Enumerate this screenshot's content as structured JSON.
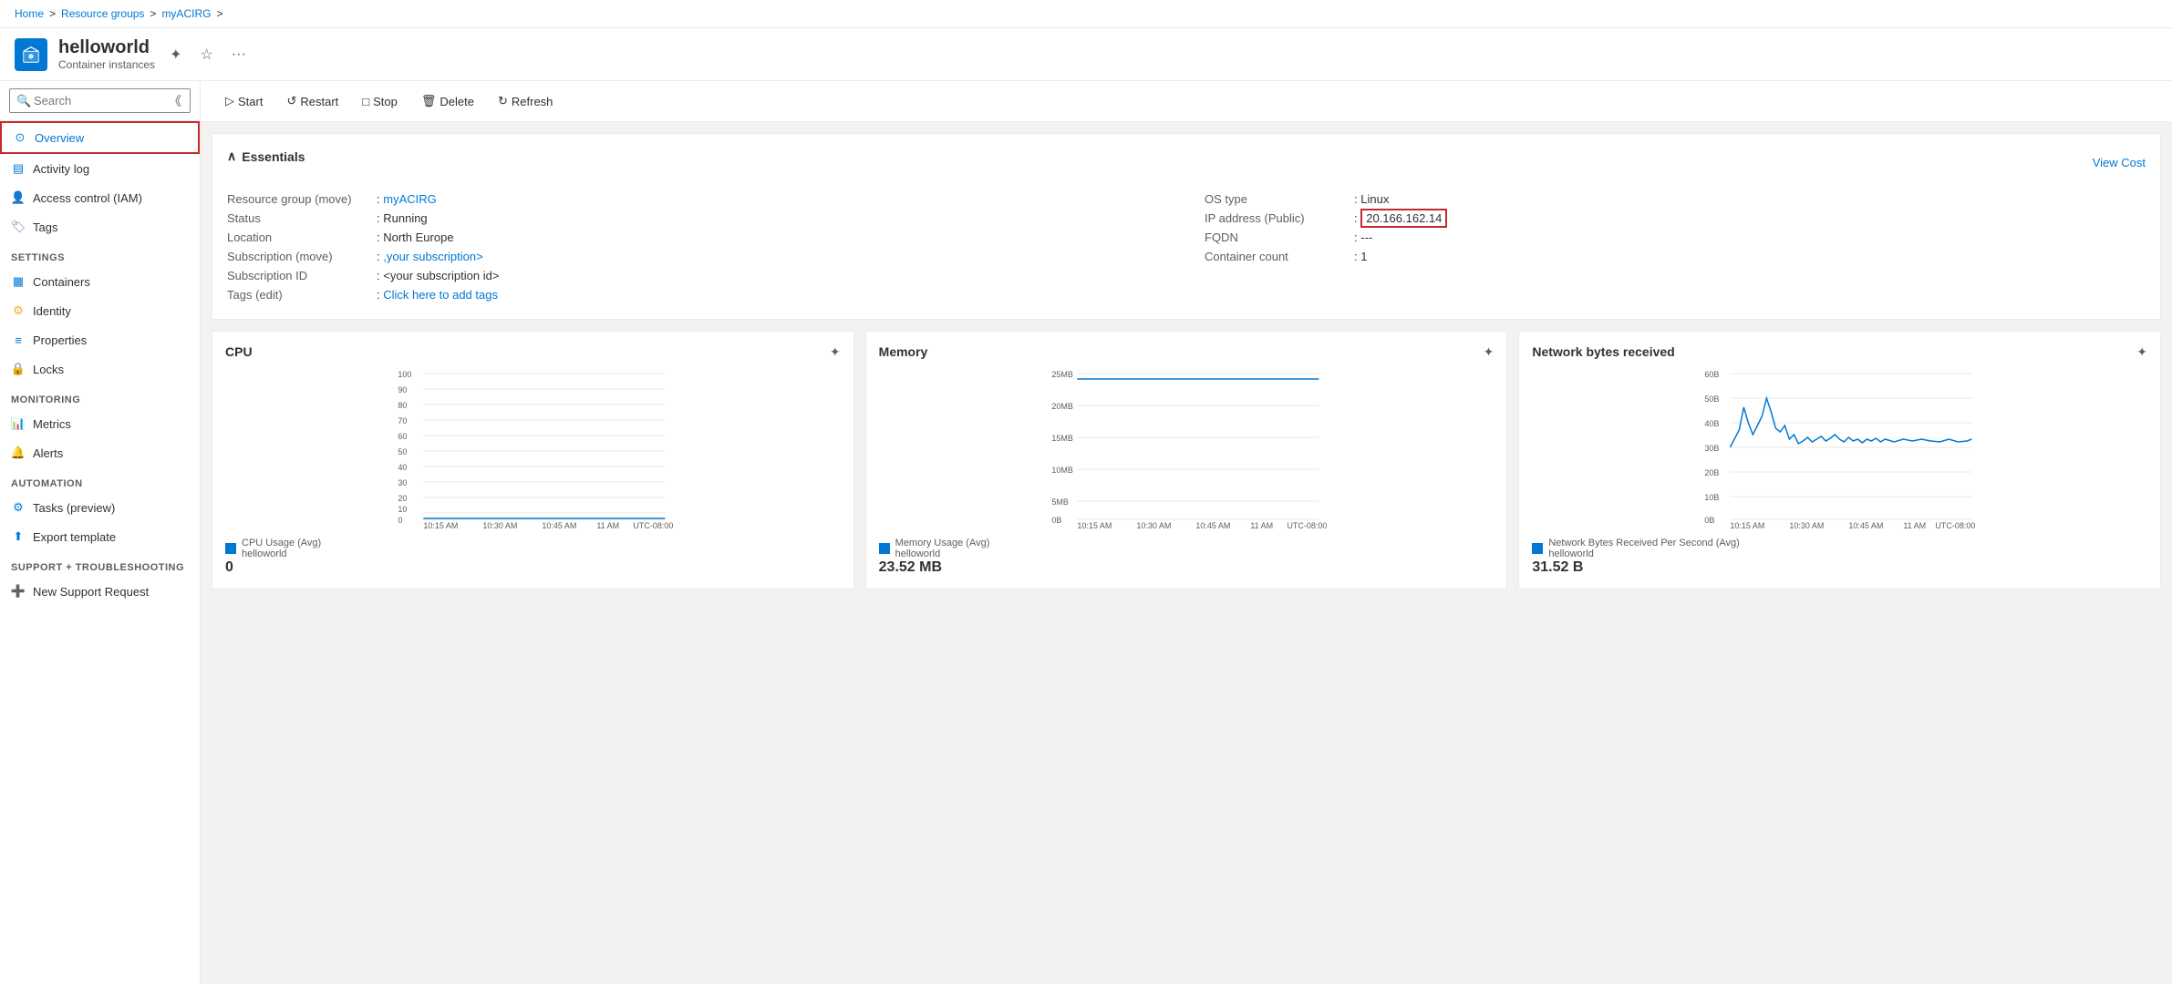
{
  "breadcrumb": {
    "items": [
      "Home",
      "Resource groups",
      "myACIRG"
    ],
    "separators": [
      ">",
      ">",
      ">"
    ]
  },
  "resource": {
    "name": "helloworld",
    "subtitle": "Container instances",
    "icon_color": "#0078d4"
  },
  "toolbar": {
    "start_label": "Start",
    "restart_label": "Restart",
    "stop_label": "Stop",
    "delete_label": "Delete",
    "refresh_label": "Refresh"
  },
  "search": {
    "placeholder": "Search"
  },
  "sidebar": {
    "overview": "Overview",
    "activity_log": "Activity log",
    "access_control": "Access control (IAM)",
    "tags": "Tags",
    "settings_section": "Settings",
    "containers": "Containers",
    "identity": "Identity",
    "properties": "Properties",
    "locks": "Locks",
    "monitoring_section": "Monitoring",
    "metrics": "Metrics",
    "alerts": "Alerts",
    "automation_section": "Automation",
    "tasks": "Tasks (preview)",
    "export_template": "Export template",
    "support_section": "Support + troubleshooting",
    "new_support": "New Support Request"
  },
  "essentials": {
    "section_title": "Essentials",
    "view_cost": "View Cost",
    "resource_group_label": "Resource group (move)",
    "resource_group_value": "myACIRG",
    "resource_group_link": true,
    "status_label": "Status",
    "status_value": "Running",
    "location_label": "Location",
    "location_value": "North Europe",
    "subscription_label": "Subscription (move)",
    "subscription_value": ",your subscription>",
    "subscription_id_label": "Subscription ID",
    "subscription_id_value": "<your subscription id>",
    "tags_label": "Tags (edit)",
    "tags_value": "Click here to add tags",
    "os_type_label": "OS type",
    "os_type_value": "Linux",
    "ip_address_label": "IP address (Public)",
    "ip_address_value": "20.166.162.14",
    "fqdn_label": "FQDN",
    "fqdn_value": "---",
    "container_count_label": "Container count",
    "container_count_value": "1"
  },
  "charts": {
    "cpu": {
      "title": "CPU",
      "legend_text": "CPU Usage (Avg)\nhelloworld",
      "value": "0",
      "x_labels": [
        "10:15 AM",
        "10:30 AM",
        "10:45 AM",
        "11 AM",
        "UTC-08:00"
      ],
      "y_labels": [
        "100",
        "90",
        "80",
        "70",
        "60",
        "50",
        "40",
        "30",
        "20",
        "10",
        "0"
      ]
    },
    "memory": {
      "title": "Memory",
      "legend_text": "Memory Usage (Avg)\nhelloworld",
      "value": "23.52 MB",
      "x_labels": [
        "10:15 AM",
        "10:30 AM",
        "10:45 AM",
        "11 AM",
        "UTC-08:00"
      ],
      "y_labels": [
        "25MB",
        "20MB",
        "15MB",
        "10MB",
        "5MB",
        "0B"
      ]
    },
    "network": {
      "title": "Network bytes received",
      "legend_text": "Network Bytes Received Per Second (Avg)\nhelloworld",
      "value": "31.52 B",
      "x_labels": [
        "10:15 AM",
        "10:30 AM",
        "10:45 AM",
        "11 AM",
        "UTC-08:00"
      ],
      "y_labels": [
        "60B",
        "50B",
        "40B",
        "30B",
        "20B",
        "10B",
        "0B"
      ]
    }
  }
}
